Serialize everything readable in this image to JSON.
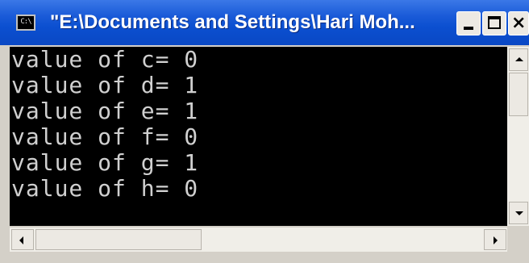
{
  "window": {
    "title": "\"E:\\Documents and Settings\\Hari Moh...",
    "app_icon_text": "C:\\",
    "controls": {
      "minimize": "minimize",
      "maximize": "maximize",
      "close": "×"
    }
  },
  "console": {
    "lines": [
      "value of c= 0",
      "value of d= 1",
      "value of e= 1",
      "value of f= 0",
      "value of g= 1",
      "value of h= 0"
    ]
  },
  "colors": {
    "titlebar": "#0b4fd0",
    "console_bg": "#000000",
    "console_text": "#d0d0d0"
  }
}
